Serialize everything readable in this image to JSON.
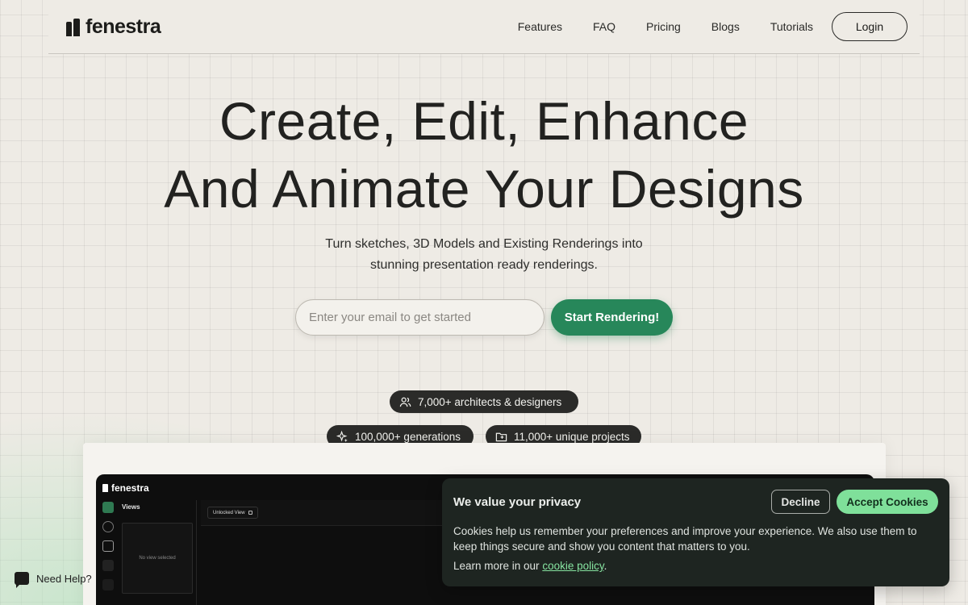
{
  "brand": {
    "name": "fenestra"
  },
  "nav": {
    "links": [
      "Features",
      "FAQ",
      "Pricing",
      "Blogs",
      "Tutorials"
    ],
    "login_label": "Login"
  },
  "hero": {
    "title_line1": "Create, Edit, Enhance",
    "title_line2": "And Animate Your Designs",
    "subtitle_line1": "Turn sketches, 3D Models and Existing Renderings into",
    "subtitle_line2": "stunning presentation ready renderings.",
    "email_placeholder": "Enter your email to get started",
    "cta_label": "Start Rendering!"
  },
  "stats": {
    "architects": "7,000+ architects & designers",
    "generations": "100,000+ generations",
    "projects": "11,000+ unique projects"
  },
  "app_preview": {
    "logo": "fenestra",
    "views_label": "Views",
    "no_view": "No view selected",
    "unlocked_view": "Unlocked View"
  },
  "help": {
    "label": "Need Help?"
  },
  "cookie": {
    "title": "We value your privacy",
    "decline_label": "Decline",
    "accept_label": "Accept Cookies",
    "body": "Cookies help us remember your preferences and improve your experience. We also use them to keep things secure and show you content that matters to you.",
    "learn_prefix": "Learn more in our ",
    "learn_link": "cookie policy",
    "learn_suffix": "."
  },
  "colors": {
    "background": "#eeebe5",
    "accent_green": "#27875a",
    "cookie_bg": "#1e2521",
    "accept_green": "#7fe09a"
  }
}
